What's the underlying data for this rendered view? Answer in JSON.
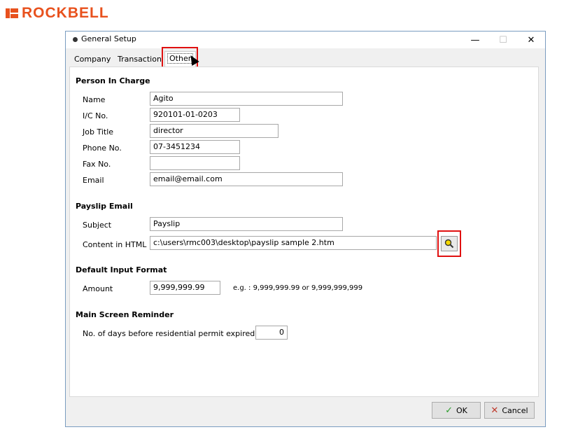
{
  "brand": {
    "name": "ROCKBELL",
    "color": "#e8511d"
  },
  "window": {
    "title": "General Setup",
    "min": "—",
    "max": "☐",
    "close": "✕"
  },
  "tabs": [
    {
      "label": "Company"
    },
    {
      "label": "Transaction"
    },
    {
      "label": "Other",
      "active": true
    }
  ],
  "person": {
    "section": "Person In Charge",
    "name_label": "Name",
    "name_value": "Agito",
    "ic_label": "I/C No.",
    "ic_value": "920101-01-0203",
    "job_label": "Job Title",
    "job_value": "director",
    "phone_label": "Phone No.",
    "phone_value": "07-3451234",
    "fax_label": "Fax No.",
    "fax_value": "",
    "email_label": "Email",
    "email_value": "email@email.com"
  },
  "payslip": {
    "section": "Payslip Email",
    "subject_label": "Subject",
    "subject_value": "Payslip",
    "content_label": "Content in HTML",
    "content_value": "c:\\users\\rmc003\\desktop\\payslip sample 2.htm",
    "browse_icon": "magnifier-icon"
  },
  "input_format": {
    "section": "Default Input Format",
    "amount_label": "Amount",
    "amount_value": "9,999,999.99",
    "hint": "e.g. : 9,999,999.99 or 9,999,999,999"
  },
  "reminder": {
    "section": "Main Screen Reminder",
    "days_label": "No. of days before residential permit expired",
    "days_value": "0"
  },
  "buttons": {
    "ok": "OK",
    "cancel": "Cancel",
    "ok_color": "#2a9d2a",
    "cancel_color": "#c0392b"
  },
  "highlight_color": "#e01010"
}
